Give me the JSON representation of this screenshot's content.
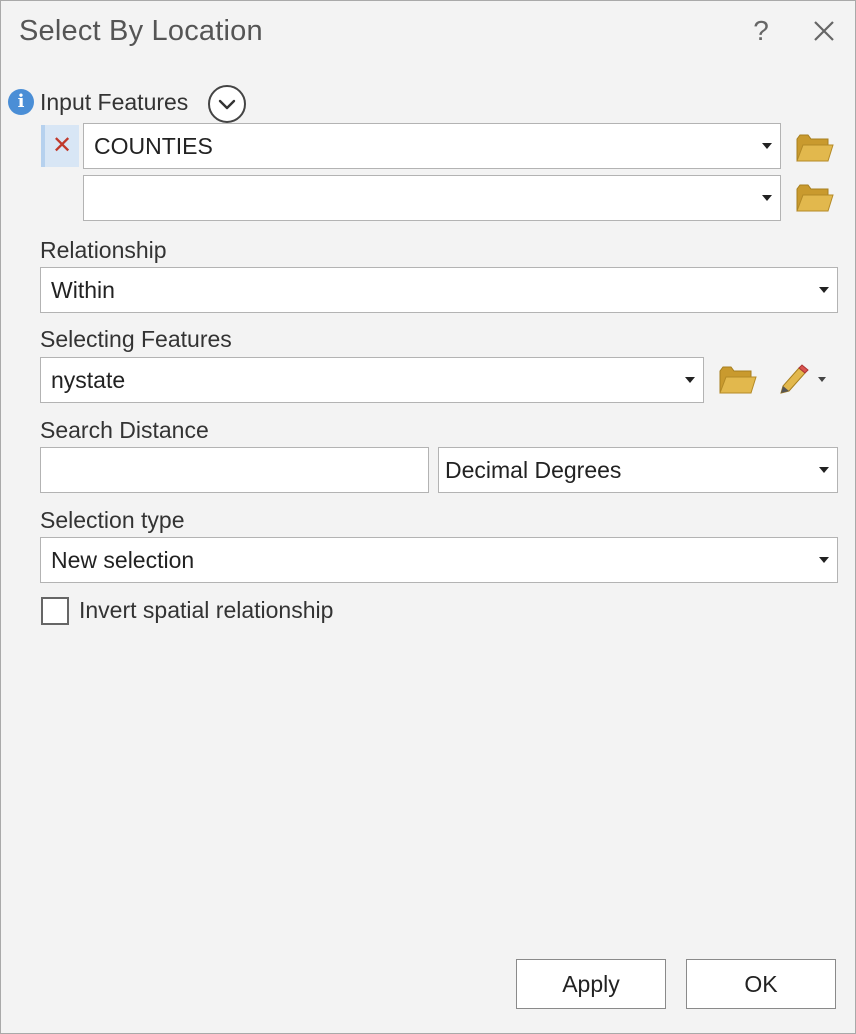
{
  "dialog": {
    "title": "Select By Location",
    "help_label": "?"
  },
  "input_features": {
    "label": "Input Features",
    "rows": [
      {
        "value": "COUNTIES"
      },
      {
        "value": ""
      }
    ]
  },
  "relationship": {
    "label": "Relationship",
    "value": "Within"
  },
  "selecting_features": {
    "label": "Selecting Features",
    "value": "nystate"
  },
  "search_distance": {
    "label": "Search Distance",
    "value": "",
    "unit": "Decimal Degrees"
  },
  "selection_type": {
    "label": "Selection type",
    "value": "New selection"
  },
  "invert": {
    "label": "Invert spatial relationship",
    "checked": false
  },
  "buttons": {
    "apply": "Apply",
    "ok": "OK"
  },
  "colors": {
    "info": "#4a8ed6",
    "remove": "#c0392b",
    "folder": "#e2b84d"
  }
}
